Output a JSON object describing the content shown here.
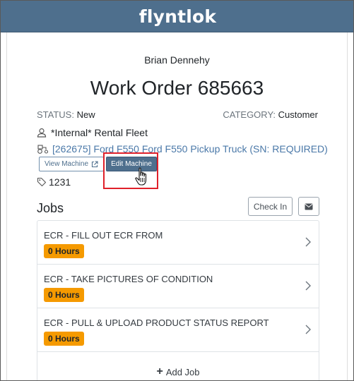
{
  "app": {
    "logo_text": "flyntlok",
    "brand_color": "#4e6f8d",
    "accent_badge_color": "#f59a00"
  },
  "work_order": {
    "customer_name": "Brian Dennehy",
    "title": "Work Order 685663",
    "status_label": "STATUS:",
    "status_value": "New",
    "category_label": "CATEGORY:",
    "category_value": "Customer",
    "owner": "*Internal* Rental Fleet",
    "machine_link": "[262675] Ford F550 Ford F550 Pickup Truck (SN: REQUIRED)",
    "tag_value": "1231"
  },
  "actions": {
    "view_machine_label": "View Machine",
    "edit_machine_label": "Edit Machine",
    "check_in_label": "Check In"
  },
  "jobs": {
    "heading": "Jobs",
    "items": [
      {
        "name": "ECR - FILL OUT ECR FROM",
        "hours": "0 Hours"
      },
      {
        "name": "ECR - TAKE PICTURES OF CONDITION",
        "hours": "0 Hours"
      },
      {
        "name": "ECR - PULL & UPLOAD PRODUCT STATUS REPORT",
        "hours": "0 Hours"
      }
    ],
    "add_job_label": "Add Job"
  },
  "icons": {
    "user": "user-icon",
    "machine": "tractor-icon",
    "external": "external-link-icon",
    "tag": "tag-icon",
    "mail": "envelope-icon",
    "chevron": "chevron-right-icon",
    "cursor": "hand-pointer-icon"
  }
}
